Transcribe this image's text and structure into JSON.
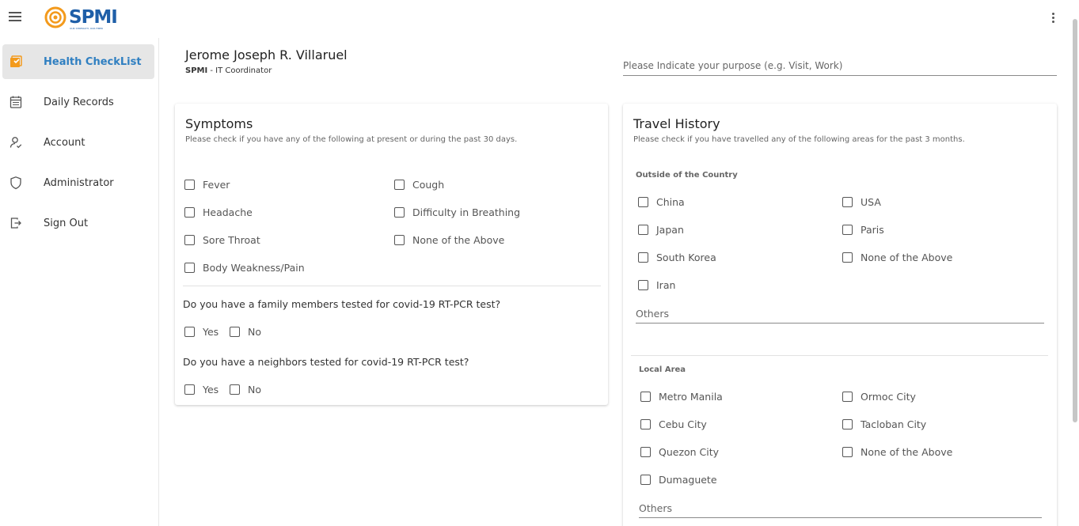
{
  "app": {
    "logo_text": "SPMI",
    "logo_tagline": "OUR STRENGTH, OUR FIBER"
  },
  "sidebar": {
    "items": [
      {
        "label": "Health CheckList",
        "icon": "checklist-icon"
      },
      {
        "label": "Daily Records",
        "icon": "calendar-icon"
      },
      {
        "label": "Account",
        "icon": "user-icon"
      },
      {
        "label": "Administrator",
        "icon": "shield-icon"
      },
      {
        "label": "Sign Out",
        "icon": "logout-icon"
      }
    ],
    "active_color": "#2f7fc1"
  },
  "header": {
    "name": "Jerome Joseph R. Villaruel",
    "company": "SPMI",
    "role": " - IT Coordinator",
    "purpose_placeholder": "Please Indicate your purpose (e.g. Visit, Work)"
  },
  "symptoms": {
    "title": "Symptoms",
    "subtitle": "Please check if you have any of the following at present or during the past 30 days.",
    "options": [
      "Fever",
      "Cough",
      "Headache",
      "Difficulty in Breathing",
      "Sore Throat",
      "None of the Above",
      "Body Weakness/Pain"
    ],
    "q1": "Do you have a family members tested for covid-19 RT-PCR test?",
    "q2": "Do you have a neighbors tested for covid-19 RT-PCR test?",
    "yes": "Yes",
    "no": "No"
  },
  "travel": {
    "title": "Travel History",
    "subtitle": "Please check if you have travelled any of the following areas for the past 3 months.",
    "outside_label": "Outside of the Country",
    "outside_options": [
      "China",
      "USA",
      "Japan",
      "Paris",
      "South Korea",
      "None of the Above",
      "Iran"
    ],
    "others_placeholder": "Others",
    "local_label": "Local Area",
    "local_options": [
      "Metro Manila",
      "Ormoc City",
      "Cebu City",
      "Tacloban City",
      "Quezon City",
      "None of the Above",
      "Dumaguete"
    ]
  }
}
